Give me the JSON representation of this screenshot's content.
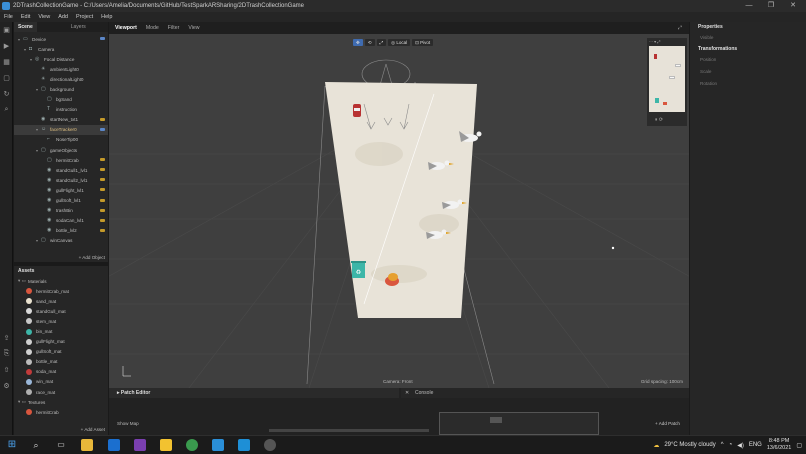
{
  "window": {
    "title": "2DTrashCollectionGame - C:/Users/Amelia/Documents/GitHub/TestSparkARSharing/2DTrashCollectionGame",
    "minimize": "—",
    "maximize": "❐",
    "close": "✕"
  },
  "menu": [
    "File",
    "Edit",
    "View",
    "Add",
    "Project",
    "Help"
  ],
  "scene_panel": {
    "tabs": [
      "Scene",
      "Layers"
    ],
    "tree": [
      {
        "label": "Device",
        "depth": 0,
        "arrow": "▾",
        "icon": "▭",
        "badge": "blue"
      },
      {
        "label": "Camera",
        "depth": 1,
        "arrow": "▾",
        "icon": "◘"
      },
      {
        "label": "Focal Distance",
        "depth": 2,
        "arrow": "▾",
        "icon": "◎"
      },
      {
        "label": "ambientLight0",
        "depth": 3,
        "arrow": "",
        "icon": "☀"
      },
      {
        "label": "directionalLight0",
        "depth": 3,
        "arrow": "",
        "icon": "☀"
      },
      {
        "label": "background",
        "depth": 3,
        "arrow": "▾",
        "icon": "▢"
      },
      {
        "label": "bgSand",
        "depth": 4,
        "arrow": "",
        "icon": "▢"
      },
      {
        "label": "instruction",
        "depth": 4,
        "arrow": "",
        "icon": "T"
      },
      {
        "label": "startNew_txt1",
        "depth": 3,
        "arrow": "",
        "icon": "◉",
        "badge": "gold"
      },
      {
        "label": "faceTracker0",
        "depth": 3,
        "arrow": "▾",
        "icon": "☺",
        "badge": "blue",
        "selected": true
      },
      {
        "label": "NoseTip00",
        "depth": 4,
        "arrow": "",
        "icon": "⌐"
      },
      {
        "label": "gameObjects",
        "depth": 3,
        "arrow": "▾",
        "icon": "▢"
      },
      {
        "label": "hermitCrab",
        "depth": 4,
        "arrow": "",
        "icon": "▢",
        "badge": "gold"
      },
      {
        "label": "standGull1_lvl1",
        "depth": 4,
        "arrow": "",
        "icon": "◉",
        "badge": "gold"
      },
      {
        "label": "standGull2_lvl1",
        "depth": 4,
        "arrow": "",
        "icon": "◉",
        "badge": "gold"
      },
      {
        "label": "gullFlight_lvl1",
        "depth": 4,
        "arrow": "",
        "icon": "◉",
        "badge": "gold"
      },
      {
        "label": "gullSoft_lvl1",
        "depth": 4,
        "arrow": "",
        "icon": "◉",
        "badge": "gold"
      },
      {
        "label": "trashBin",
        "depth": 4,
        "arrow": "",
        "icon": "◉",
        "badge": "gold"
      },
      {
        "label": "sodaCan_lvl1",
        "depth": 4,
        "arrow": "",
        "icon": "◉",
        "badge": "gold"
      },
      {
        "label": "bottle_lvl2",
        "depth": 4,
        "arrow": "",
        "icon": "◉",
        "badge": "gold"
      },
      {
        "label": "winCanvas",
        "depth": 3,
        "arrow": "▾",
        "icon": "▢"
      }
    ],
    "add_object": "+ Add Object"
  },
  "assets_panel": {
    "title": "Assets",
    "items": [
      {
        "label": "Materials",
        "depth": 0,
        "type": "folder"
      },
      {
        "label": "hermitCrab_mat",
        "depth": 1,
        "color": "#d9563e"
      },
      {
        "label": "sand_mat",
        "depth": 1,
        "color": "#e9e2cf"
      },
      {
        "label": "standGull_mat",
        "depth": 1,
        "color": "#d8d8d8"
      },
      {
        "label": "stem_mat",
        "depth": 1,
        "color": "#c8c8c8"
      },
      {
        "label": "bin_mat",
        "depth": 1,
        "color": "#3db6a8"
      },
      {
        "label": "gullFlight_mat",
        "depth": 1,
        "color": "#d0d0d0"
      },
      {
        "label": "gullSoft_mat",
        "depth": 1,
        "color": "#d0d0d0"
      },
      {
        "label": "bottle_mat",
        "depth": 1,
        "color": "#bcbcbc"
      },
      {
        "label": "soda_mat",
        "depth": 1,
        "color": "#c23b3b"
      },
      {
        "label": "win_mat",
        "depth": 1,
        "color": "#9ab7d9"
      },
      {
        "label": "race_mat",
        "depth": 1,
        "color": "#b0b0b0"
      },
      {
        "label": "Textures",
        "depth": 0,
        "type": "folder"
      },
      {
        "label": "hermitCrab",
        "depth": 1,
        "color": "#d9563e"
      }
    ],
    "add_asset": "+ Add Asset"
  },
  "viewport": {
    "tabs": [
      "Viewport",
      "Mode",
      "Filter",
      "View"
    ],
    "toolbar": [
      "✥",
      "⟲",
      "⤢",
      "◎ Local",
      "⊡ Pivot"
    ],
    "camera_label": "Camera: Front",
    "grid_label": "Grid spacing: 100cm"
  },
  "bottom": {
    "patch_editor": "Patch Editor",
    "console": "Console",
    "show_map": "Show Map",
    "add_patch": "+ Add Patch"
  },
  "properties": {
    "title": "Properties",
    "rows": [
      "Visible",
      "Transformations",
      "Position",
      "Scale",
      "Rotation"
    ]
  },
  "taskbar": {
    "weather": "29°C  Mostly cloudy",
    "lang": "ENG",
    "time": "8:48 PM",
    "date": "13/6/2021"
  }
}
